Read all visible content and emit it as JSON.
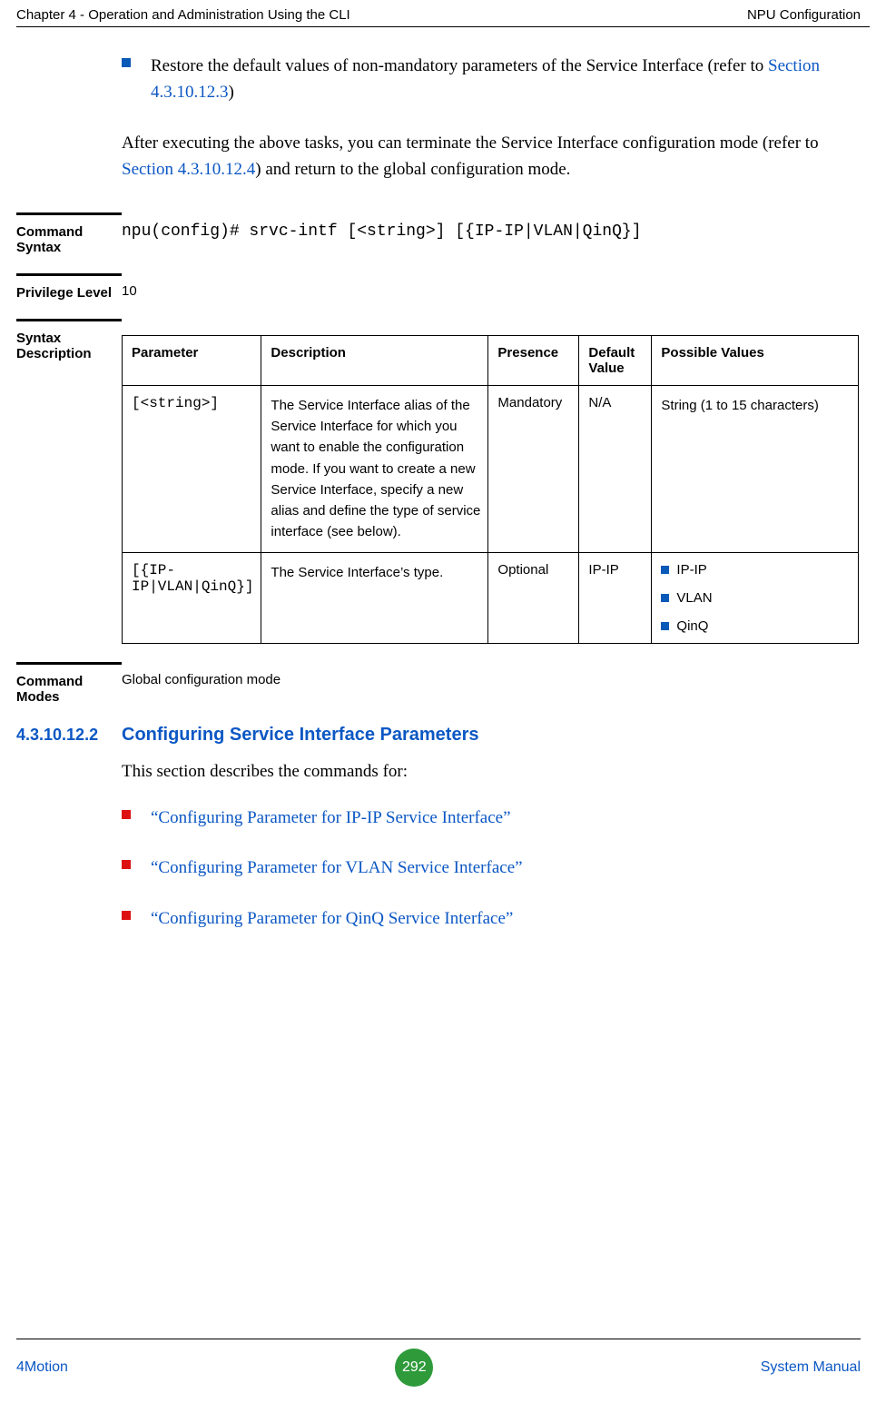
{
  "header": {
    "left": "Chapter 4 - Operation and Administration Using the CLI",
    "right": "NPU Configuration"
  },
  "top": {
    "bullet_pre": "Restore the default values of non-mandatory parameters of the Service Interface (refer to ",
    "bullet_link": "Section 4.3.10.12.3",
    "bullet_post": ")",
    "para_pre": "After executing the above tasks, you can terminate the Service Interface configuration mode (refer to ",
    "para_link": "Section 4.3.10.12.4",
    "para_post": ") and return to the global configuration mode."
  },
  "cmd_syntax": {
    "label": "Command Syntax",
    "value": "npu(config)# srvc-intf [<string>] [{IP-IP|VLAN|QinQ}]"
  },
  "privilege": {
    "label": "Privilege Level",
    "value": "10"
  },
  "syntax_desc": {
    "label": "Syntax Description",
    "headers": {
      "parameter": "Parameter",
      "description": "Description",
      "presence": "Presence",
      "default": "Default Value",
      "possible": "Possible Values"
    },
    "rows": [
      {
        "param": "[<string>]",
        "desc": "The Service Interface alias of the Service Interface for which you want to enable the configuration mode. If you want to create a new Service Interface, specify a new alias and define the type of service interface (see below).",
        "presence": "Mandatory",
        "default": "N/A",
        "possible_text": "String (1 to 15 characters)"
      },
      {
        "param": "[{IP-IP|VLAN|QinQ}]",
        "desc": "The Service Interface’s type.",
        "presence": "Optional",
        "default": "IP-IP",
        "possible_list": [
          "IP-IP",
          "VLAN",
          "QinQ"
        ]
      }
    ]
  },
  "cmd_modes": {
    "label": "Command Modes",
    "value": "Global configuration mode"
  },
  "section": {
    "number": "4.3.10.12.2",
    "title": "Configuring Service Interface Parameters",
    "intro": "This section describes the commands for:",
    "links": [
      "“Configuring Parameter for IP-IP Service Interface”",
      "“Configuring Parameter for VLAN Service Interface”",
      "“Configuring Parameter for QinQ Service Interface”"
    ]
  },
  "footer": {
    "left": "4Motion",
    "page": "292",
    "right": "System Manual"
  }
}
